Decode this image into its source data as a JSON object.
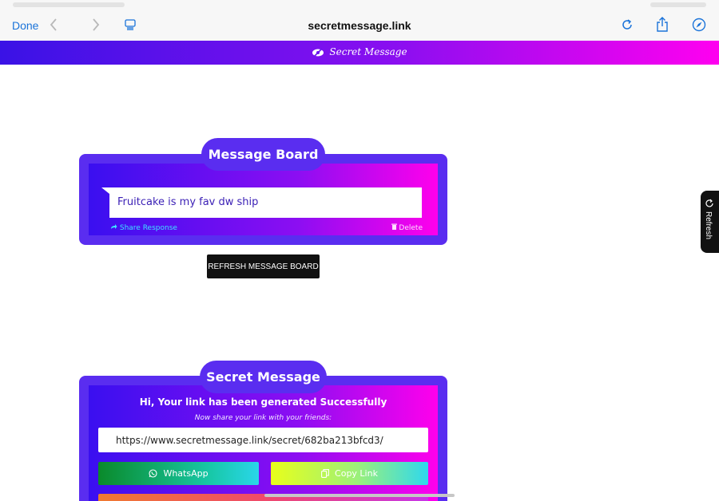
{
  "browser": {
    "done_label": "Done",
    "url": "secretmessage.link"
  },
  "site": {
    "brand_name": "Secret Message",
    "accent_colors": [
      "#3a12e6",
      "#8a0ff0",
      "#ff00f0",
      "#5a2df0"
    ]
  },
  "message_board": {
    "title": "Message Board",
    "messages": [
      {
        "text": "Fruitcake is my fav dw ship",
        "share_label": "Share Response",
        "delete_label": "Delete"
      }
    ],
    "refresh_button": "REFRESH MESSAGE BOARD"
  },
  "side_tab": {
    "label": "Refresh"
  },
  "secret_message": {
    "title": "Secret Message",
    "success_text": "Hi, Your link has been generated Successfully",
    "share_hint": "Now share your link with your friends:",
    "link_value": "https://www.secretmessage.link/secret/682ba213bfcd3/",
    "whatsapp_label": "WhatsApp",
    "copy_label": "Copy Link"
  },
  "icons": [
    "back-chevron-icon",
    "forward-chevron-icon",
    "reader-icon",
    "reload-icon",
    "share-icon",
    "compass-icon",
    "eye-icon",
    "share-arrow-icon",
    "trash-icon",
    "whatsapp-icon",
    "copy-icon",
    "refresh-icon"
  ]
}
